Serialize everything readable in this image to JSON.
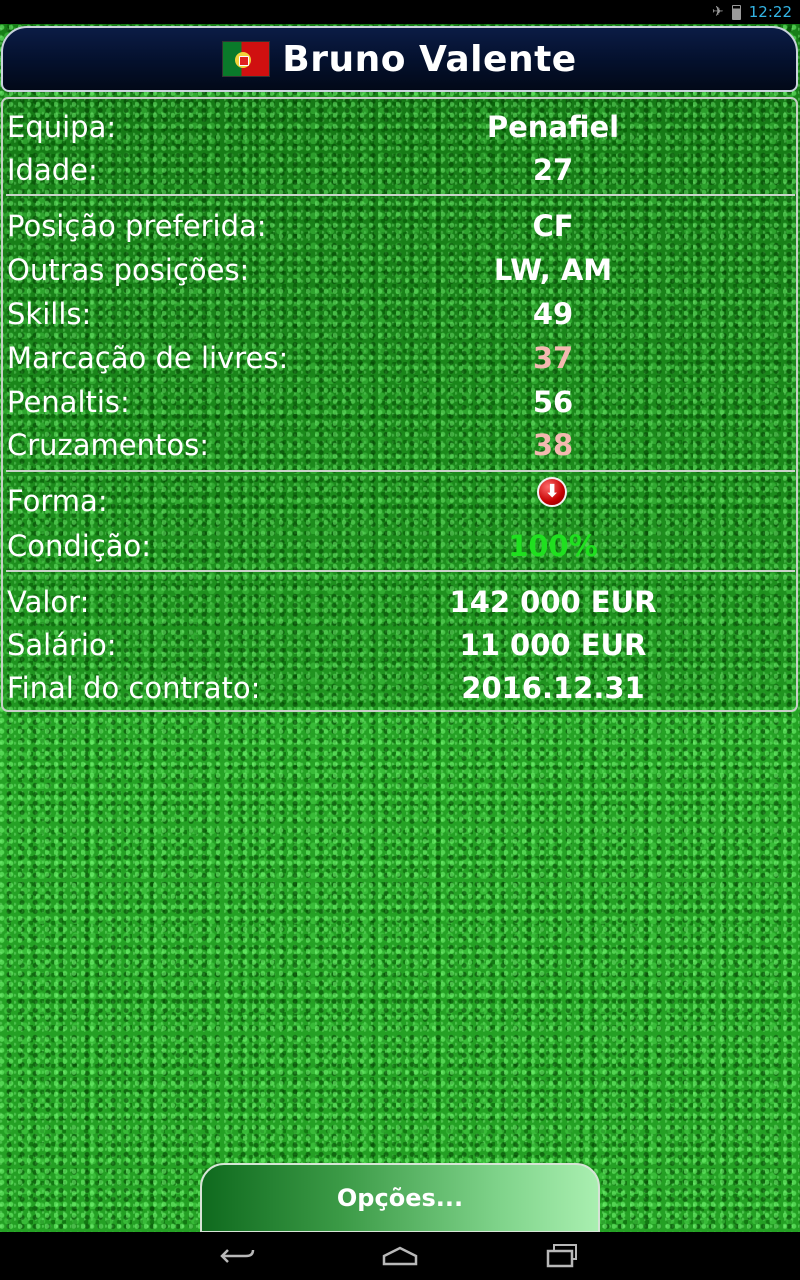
{
  "status": {
    "time": "12:22",
    "icons": [
      "airplane-icon",
      "battery-icon"
    ]
  },
  "header": {
    "name": "Bruno Valente",
    "flag": "portugal-flag"
  },
  "info": {
    "team": {
      "label": "Equipa:",
      "value": "Penafiel"
    },
    "age": {
      "label": "Idade:",
      "value": "27"
    },
    "preferred_position": {
      "label": "Posição preferida:",
      "value": "CF"
    },
    "other_positions": {
      "label": "Outras posições:",
      "value": "LW, AM"
    },
    "skills": {
      "label": "Skills:",
      "value": "49"
    },
    "free_kicks": {
      "label": "Marcação de livres:",
      "value": "37",
      "color": "#f3b9b0"
    },
    "penalties": {
      "label": "Penaltis:",
      "value": "56"
    },
    "crossing": {
      "label": "Cruzamentos:",
      "value": "38",
      "color": "#f3b9b0"
    },
    "form": {
      "label": "Forma:",
      "icon": "arrow-down-icon",
      "color": "#c40000"
    },
    "condition": {
      "label": "Condição:",
      "value": "100%",
      "color": "#1fe01f"
    },
    "market_value": {
      "label": "Valor:",
      "value": "142 000 EUR"
    },
    "salary": {
      "label": "Salário:",
      "value": "11 000 EUR"
    },
    "contract_end": {
      "label": "Final do contrato:",
      "value": "2016.12.31"
    }
  },
  "options_button": {
    "label": "Opções..."
  },
  "navigation": {
    "back": "back-icon",
    "home": "home-icon",
    "recents": "recent-apps-icon"
  }
}
